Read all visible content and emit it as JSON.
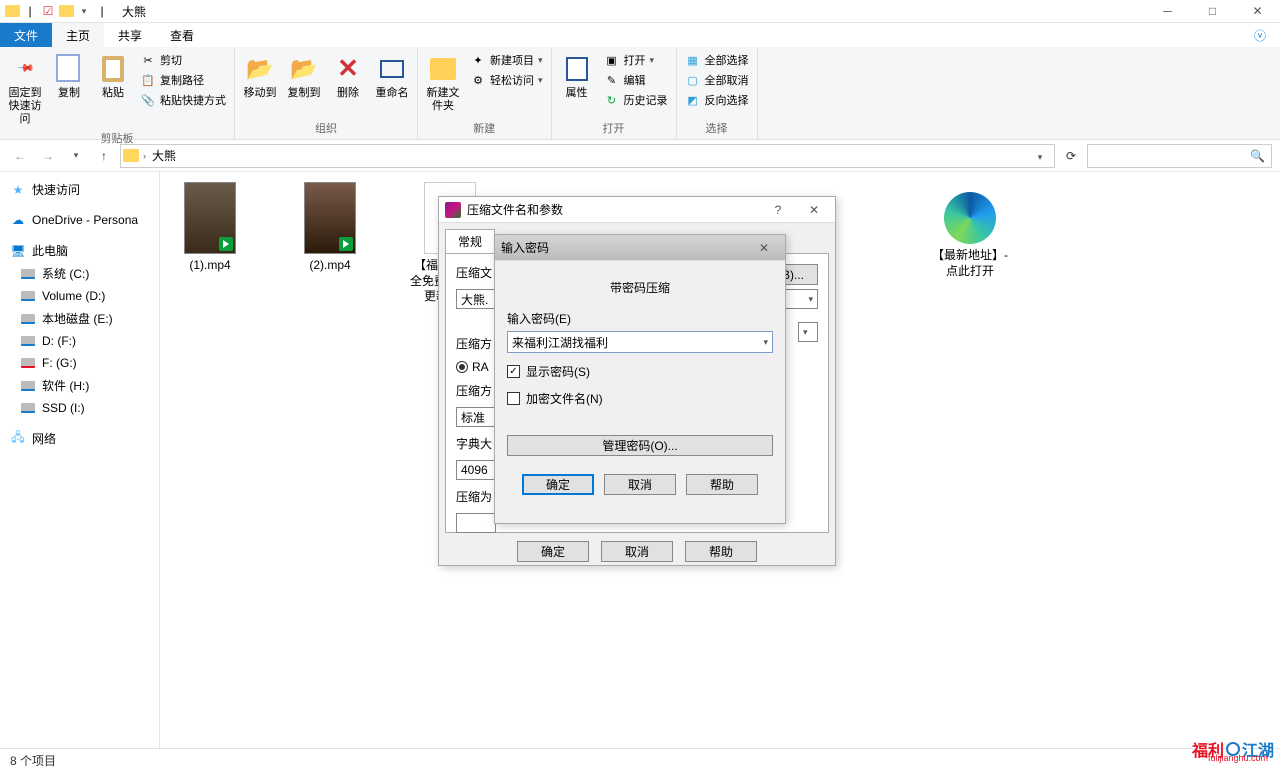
{
  "titlebar": {
    "title": "大熊"
  },
  "ribbon_tabs": {
    "file": "文件",
    "home": "主页",
    "share": "共享",
    "view": "查看"
  },
  "ribbon": {
    "pin": "固定到快速访问",
    "copy": "复制",
    "paste": "粘贴",
    "copy_path": "复制路径",
    "paste_shortcut": "粘贴快捷方式",
    "cut": "剪切",
    "group_clipboard": "剪贴板",
    "move_to": "移动到",
    "copy_to": "复制到",
    "delete": "删除",
    "rename": "重命名",
    "group_organize": "组织",
    "new_folder": "新建文件夹",
    "new_item": "新建项目",
    "easy_access": "轻松访问",
    "group_new": "新建",
    "properties": "属性",
    "open": "打开",
    "edit": "编辑",
    "history": "历史记录",
    "group_open": "打开",
    "select_all": "全部选择",
    "select_none": "全部取消",
    "invert": "反向选择",
    "group_select": "选择"
  },
  "breadcrumb": {
    "seg1": "大熊"
  },
  "nav": {
    "quick": "快速访问",
    "onedrive": "OneDrive - Persona",
    "pc": "此电脑",
    "sys": "系统 (C:)",
    "vol": "Volume (D:)",
    "local": "本地磁盘 (E:)",
    "df": "D: (F:)",
    "fg": "F: (G:)",
    "soft": "软件 (H:)",
    "ssd": "SSD (I:)",
    "network": "网络"
  },
  "files": {
    "f1": "(1).mp4",
    "f2": "(2).mp4",
    "f3": "【福利江湖】全免费-无套路-更新快.txt",
    "f4": "【最新地址】-点此打开"
  },
  "statusbar": {
    "items": "8 个项目"
  },
  "dlg1": {
    "title": "压缩文件名和参数",
    "tab_general": "常规",
    "archive_label": "压缩文",
    "archive_name": "大熊.",
    "browse": "B)...",
    "format_label": "压缩方",
    "rar": "RA",
    "method_label": "压缩方",
    "standard": "标准",
    "dict_label": "字典大",
    "dict_val": "4096",
    "split_label": "压缩为",
    "ok": "确定",
    "cancel": "取消",
    "help": "帮助"
  },
  "dlg2": {
    "title": "输入密码",
    "heading": "带密码压缩",
    "pwd_label": "输入密码(E)",
    "pwd_value": "来福利江湖找福利",
    "show_pwd": "显示密码(S)",
    "encrypt_names": "加密文件名(N)",
    "manage": "管理密码(O)...",
    "ok": "确定",
    "cancel": "取消",
    "help": "帮助"
  },
  "watermark": {
    "a": "福利",
    "b": "江湖",
    "sub": "fulijianghu.com"
  }
}
